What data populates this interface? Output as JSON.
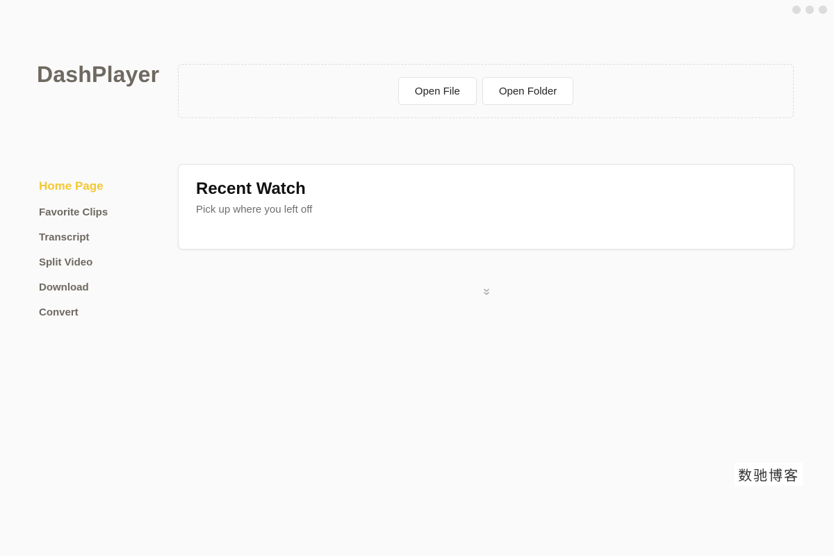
{
  "app": {
    "title": "DashPlayer"
  },
  "window_controls": [
    "minimize-icon",
    "maximize-icon",
    "close-icon"
  ],
  "toolbar": {
    "open_file_label": "Open File",
    "open_folder_label": "Open Folder"
  },
  "sidebar": {
    "items": [
      {
        "label": "Home Page",
        "active": true
      },
      {
        "label": "Favorite Clips",
        "active": false
      },
      {
        "label": "Transcript",
        "active": false
      },
      {
        "label": "Split Video",
        "active": false
      },
      {
        "label": "Download",
        "active": false
      },
      {
        "label": "Convert",
        "active": false
      }
    ]
  },
  "recent": {
    "title": "Recent Watch",
    "subtitle": "Pick up where you left off"
  },
  "expand": {
    "icon": "chevrons-down-icon"
  },
  "watermark": {
    "text": "数驰博客"
  },
  "colors": {
    "accent": "#f3c833",
    "nav_text": "#6e6961",
    "background": "#fafafa"
  }
}
